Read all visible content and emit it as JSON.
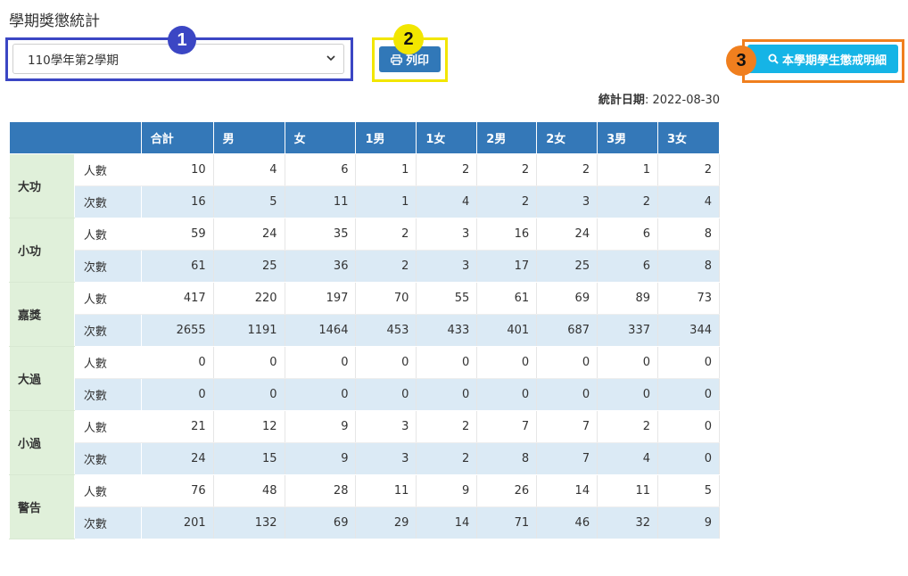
{
  "page": {
    "title": "學期獎懲統計"
  },
  "controls": {
    "term_select_value": "110學年第2學期",
    "print_label": "列印",
    "detail_label": "本學期學生懲戒明細"
  },
  "callouts": [
    "1",
    "2",
    "3"
  ],
  "stat_date": {
    "label": "統計日期",
    "value": ": 2022-08-30"
  },
  "table": {
    "headers": [
      "",
      "合計",
      "男",
      "女",
      "1男",
      "1女",
      "2男",
      "2女",
      "3男",
      "3女"
    ],
    "row_labels": {
      "people": "人數",
      "times": "次數"
    },
    "categories": [
      {
        "name": "大功",
        "people": [
          "10",
          "4",
          "6",
          "1",
          "2",
          "2",
          "2",
          "1",
          "2"
        ],
        "times": [
          "16",
          "5",
          "11",
          "1",
          "4",
          "2",
          "3",
          "2",
          "4"
        ]
      },
      {
        "name": "小功",
        "people": [
          "59",
          "24",
          "35",
          "2",
          "3",
          "16",
          "24",
          "6",
          "8"
        ],
        "times": [
          "61",
          "25",
          "36",
          "2",
          "3",
          "17",
          "25",
          "6",
          "8"
        ]
      },
      {
        "name": "嘉獎",
        "people": [
          "417",
          "220",
          "197",
          "70",
          "55",
          "61",
          "69",
          "89",
          "73"
        ],
        "times": [
          "2655",
          "1191",
          "1464",
          "453",
          "433",
          "401",
          "687",
          "337",
          "344"
        ]
      },
      {
        "name": "大過",
        "people": [
          "0",
          "0",
          "0",
          "0",
          "0",
          "0",
          "0",
          "0",
          "0"
        ],
        "times": [
          "0",
          "0",
          "0",
          "0",
          "0",
          "0",
          "0",
          "0",
          "0"
        ]
      },
      {
        "name": "小過",
        "people": [
          "21",
          "12",
          "9",
          "3",
          "2",
          "7",
          "7",
          "2",
          "0"
        ],
        "times": [
          "24",
          "15",
          "9",
          "3",
          "2",
          "8",
          "7",
          "4",
          "0"
        ]
      },
      {
        "name": "警告",
        "people": [
          "76",
          "48",
          "28",
          "11",
          "9",
          "26",
          "14",
          "11",
          "5"
        ],
        "times": [
          "201",
          "132",
          "69",
          "29",
          "14",
          "71",
          "46",
          "32",
          "9"
        ]
      }
    ]
  },
  "colors": {
    "header_bg": "#3478b8",
    "category_bg": "#e0f0da",
    "times_row_bg": "#dbeaf5",
    "callout_1": "#3b46c4",
    "callout_2": "#f2e600",
    "callout_3": "#f07f1e",
    "print_button": "#3178b8",
    "detail_button": "#15b4e6"
  },
  "icons": {
    "print": "printer-icon",
    "detail": "search-icon",
    "select": "chevron-down-icon"
  }
}
